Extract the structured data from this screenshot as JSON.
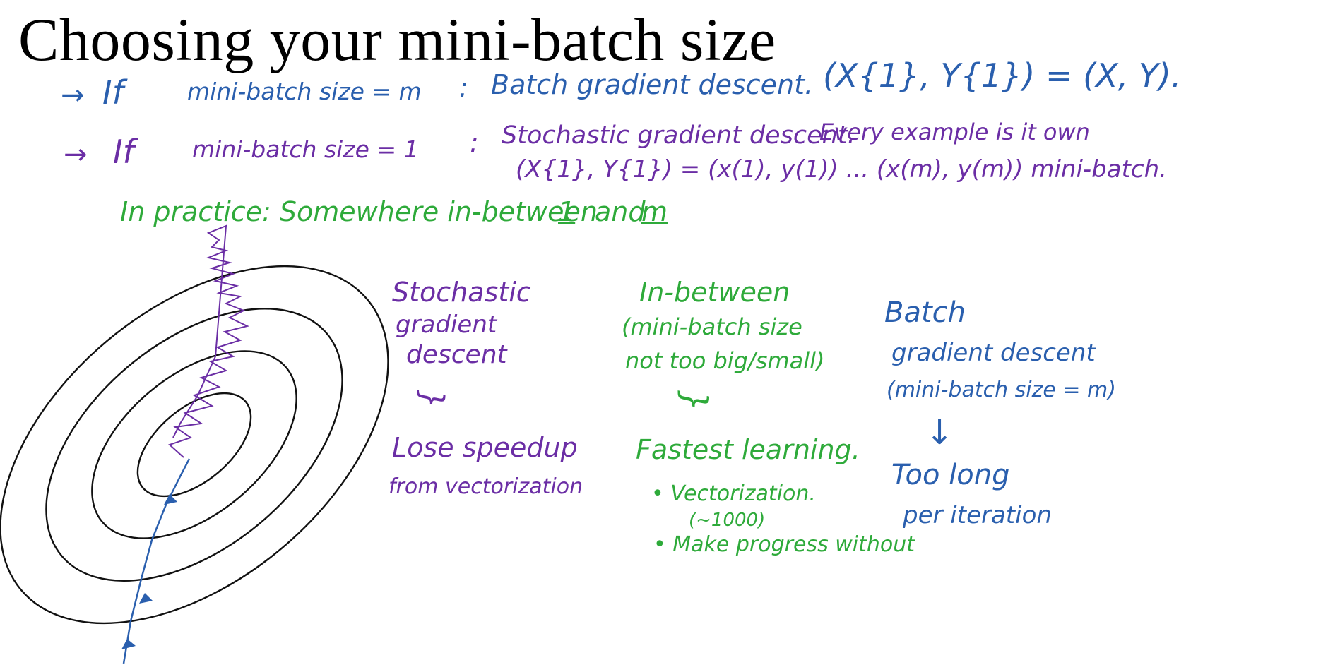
{
  "slide": {
    "title": "Choosing your mini-batch size"
  },
  "notes": {
    "line1": {
      "arrow": "→",
      "if": "If",
      "condition": "mini-batch size = m",
      "colon": ":",
      "result": "Batch gradient descent.",
      "formula": "(X{1}, Y{1}) = (X, Y)."
    },
    "line2": {
      "arrow": "→",
      "if": "If",
      "condition": "mini-batch size = 1",
      "colon": ":",
      "result": "Stochastic gradient descent.",
      "extra": "Every example is it own",
      "formula": "(X{1}, Y{1}) = (x(1), y(1)) ... (x(m), y(m)) mini-batch."
    },
    "line3": {
      "prefix": "In practice: Somewhere in-between",
      "one": "1",
      "and": "and",
      "m": "m"
    }
  },
  "columns": {
    "stochastic": {
      "heading": [
        "Stochastic",
        "gradient",
        "descent"
      ],
      "brace": "}",
      "result": [
        "Lose speedup",
        "from vectorization"
      ]
    },
    "inbetween": {
      "heading": [
        "In-between",
        "(mini-batch size",
        "not too big/small)"
      ],
      "brace": "}",
      "result": "Fastest learning.",
      "bullets": [
        "Vectorization.",
        "(~1000)",
        "Make progress without"
      ]
    },
    "batch": {
      "heading": [
        "Batch",
        "gradient descent",
        "(mini-batch size = m)"
      ],
      "arrow": "↓",
      "result": [
        "Too long",
        "per iteration"
      ]
    }
  },
  "colors": {
    "blue_ink": "#2a5fae",
    "purple_ink": "#6b2ea5",
    "green_ink": "#2eaa3a",
    "contour": "#111111"
  }
}
